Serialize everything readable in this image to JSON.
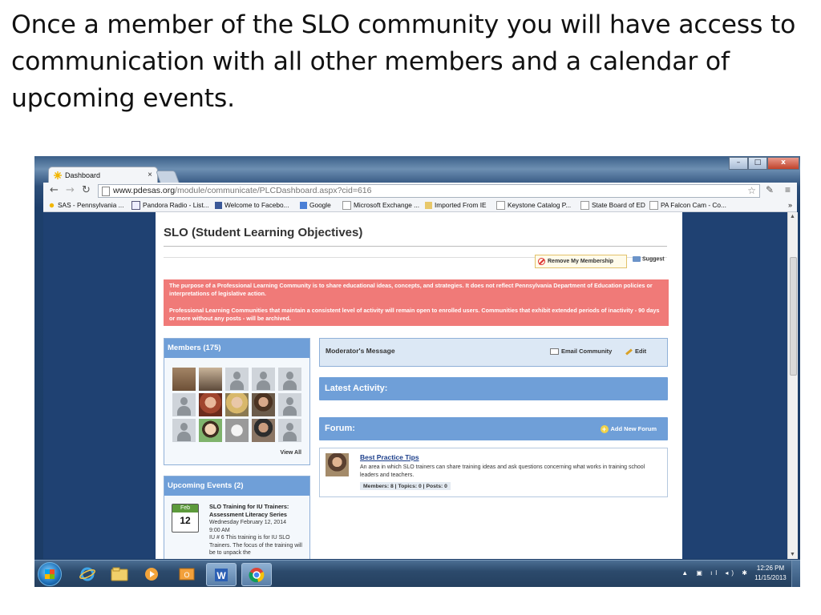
{
  "slide": {
    "caption": "Once a member of the SLO community you will have access to communication with all other members and a calendar of upcoming events."
  },
  "browser": {
    "tab_title": "Dashboard",
    "tab_close": "×",
    "url_host": "www.pdesas.org",
    "url_path": "/module/communicate/PLCDashboard.aspx?cid=616",
    "bookmarks": [
      "SAS - Pennsylvania ...",
      "Pandora Radio - List...",
      "Welcome to Facebo...",
      "Google",
      "Microsoft Exchange ...",
      "Imported From IE",
      "Keystone Catalog P...",
      "State Board of ED",
      "PA Falcon Cam - Co..."
    ],
    "bookmarks_more": "»"
  },
  "page": {
    "title": "SLO (Student Learning Objectives)",
    "remove_membership": "Remove My Membership",
    "suggest": "Suggest",
    "notice_p1": "The purpose of a Professional Learning Community is to share educational ideas, concepts, and strategies. It does not reflect Pennsylvania Department of Education policies or interpretations of legislative action.",
    "notice_p2": "Professional Learning Communities that maintain a consistent level of activity will remain open to enrolled users. Communities that exhibit extended periods of inactivity - 90 days or more without any posts - will be archived.",
    "members_heading": "Members (175)",
    "view_all": "View All",
    "events_heading": "Upcoming Events (2)",
    "event": {
      "month": "Feb",
      "day": "12",
      "title": "SLO Training for IU Trainers: Assessment Literacy Series",
      "date": "Wednesday February 12, 2014",
      "time": "9:00 AM",
      "description": "IU # 6 This training is for IU SLO Trainers. The focus of the training will be to unpack the"
    },
    "moderator_heading": "Moderator's Message",
    "email_community": "Email Community",
    "edit": "Edit",
    "latest_activity": "Latest Activity:",
    "forum_heading": "Forum:",
    "add_new_forum": "Add New Forum",
    "forum_item": {
      "name": "Best Practice Tips",
      "description": "An area in which SLO trainers can share training ideas and ask questions concerning what works in training school leaders and teachers.",
      "stats": "Members: 8   |   Topics: 0   |   Posts: 0"
    }
  },
  "taskbar": {
    "time": "12:26 PM",
    "date": "11/15/2013"
  },
  "colors": {
    "accent_blue": "#6f9fd8",
    "notice_red": "#f07a78",
    "page_background": "#1f4172"
  }
}
